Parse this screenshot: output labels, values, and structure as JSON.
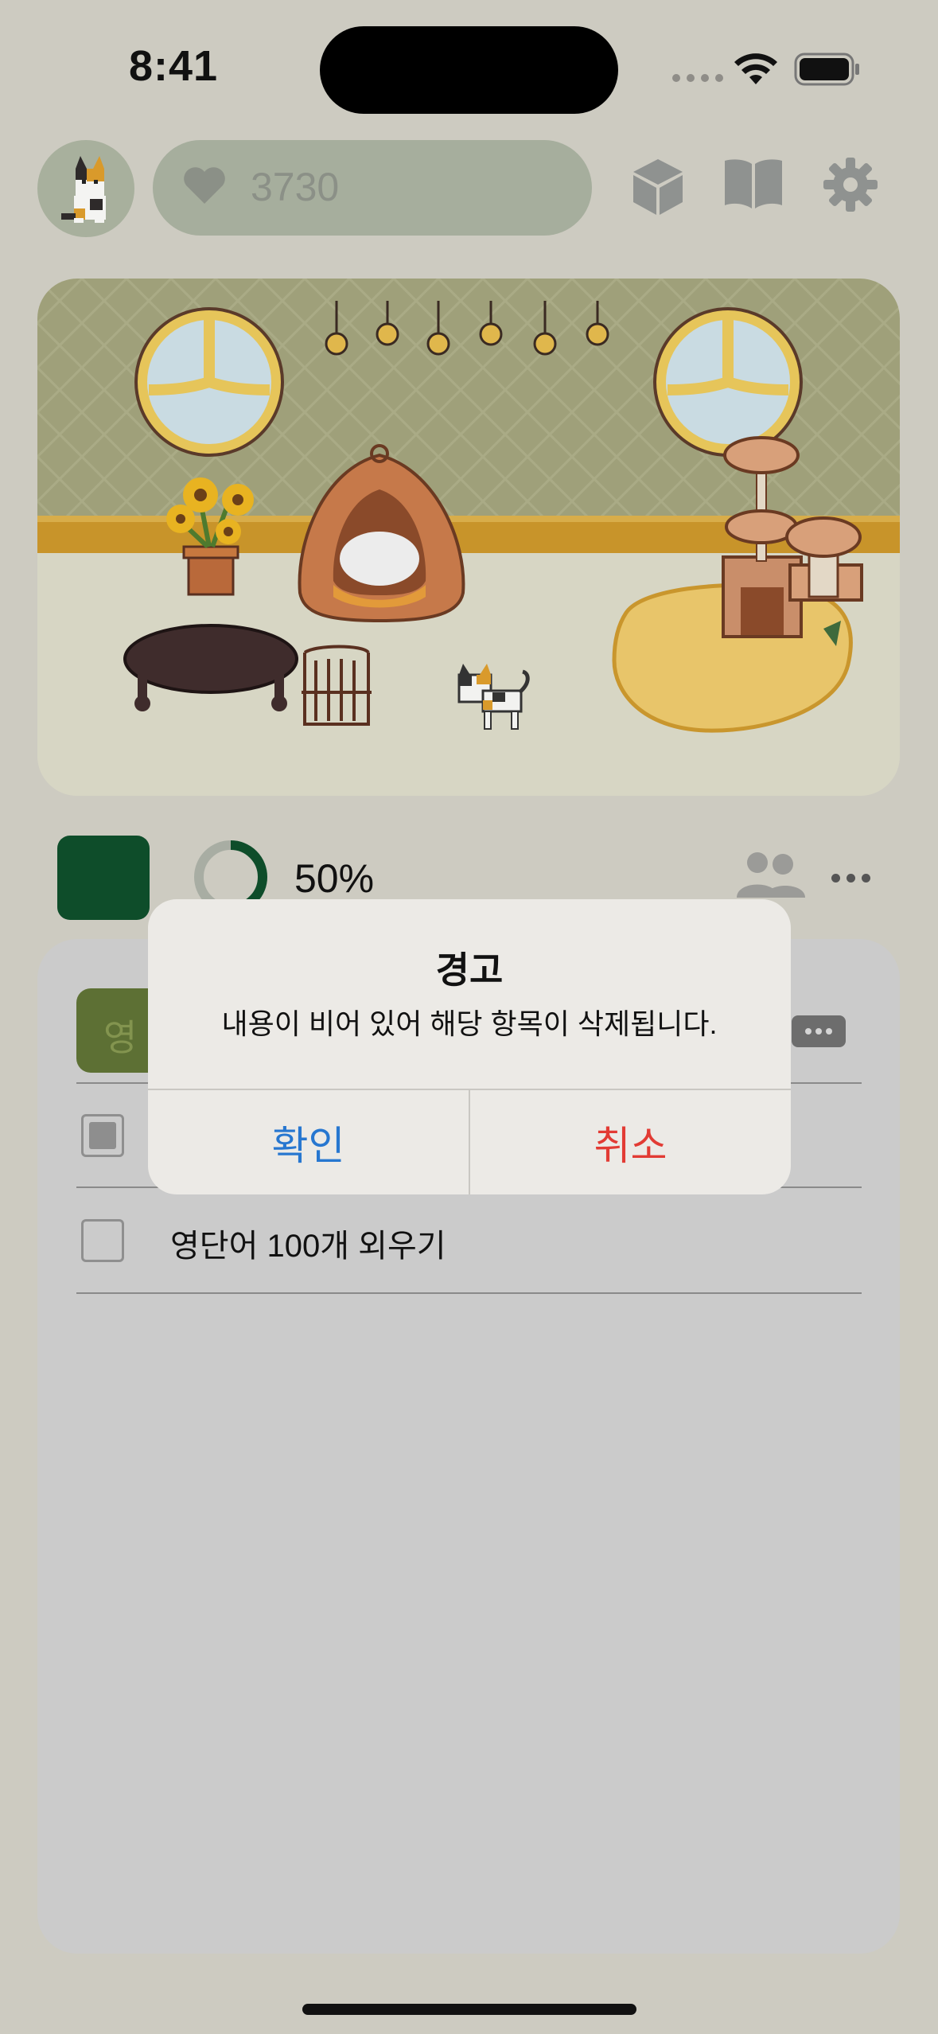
{
  "status_bar": {
    "time": "8:41"
  },
  "header": {
    "hearts": "3730"
  },
  "progress": {
    "percent_label": "50%",
    "value": 0.5
  },
  "todo": {
    "tag_label": "영",
    "items": [
      {
        "text": "",
        "checked": true
      },
      {
        "text": "영단어 100개 외우기",
        "checked": false
      }
    ]
  },
  "alert": {
    "title": "경고",
    "message": "내용이 비어 있어 해당 항목이 삭제됩니다.",
    "confirm_label": "확인",
    "cancel_label": "취소"
  },
  "colors": {
    "background": "#cdcbc1",
    "accent_green": "#0e4d2a",
    "confirm_blue": "#2777d0",
    "cancel_red": "#e23b34"
  },
  "icons": [
    "heart-icon",
    "cube-icon",
    "book-icon",
    "gear-icon",
    "friends-icon",
    "more-icon",
    "wifi-icon",
    "battery-icon",
    "cat-avatar-icon"
  ]
}
